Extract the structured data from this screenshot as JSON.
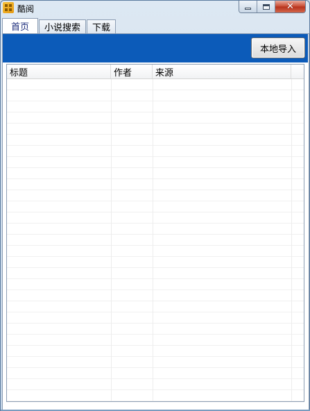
{
  "window": {
    "title": "酷阅",
    "min_icon": "minimize-icon",
    "max_icon": "maximize-icon",
    "close_icon": "close-icon",
    "close_glyph": "✕"
  },
  "tabs": [
    {
      "label": "首页",
      "active": true
    },
    {
      "label": "小说搜索",
      "active": false
    },
    {
      "label": "下载",
      "active": false
    }
  ],
  "toolbar": {
    "background": "#0c5bb9",
    "import_label": "本地导入"
  },
  "table": {
    "columns": [
      "标题",
      "作者",
      "来源"
    ],
    "rows": []
  }
}
